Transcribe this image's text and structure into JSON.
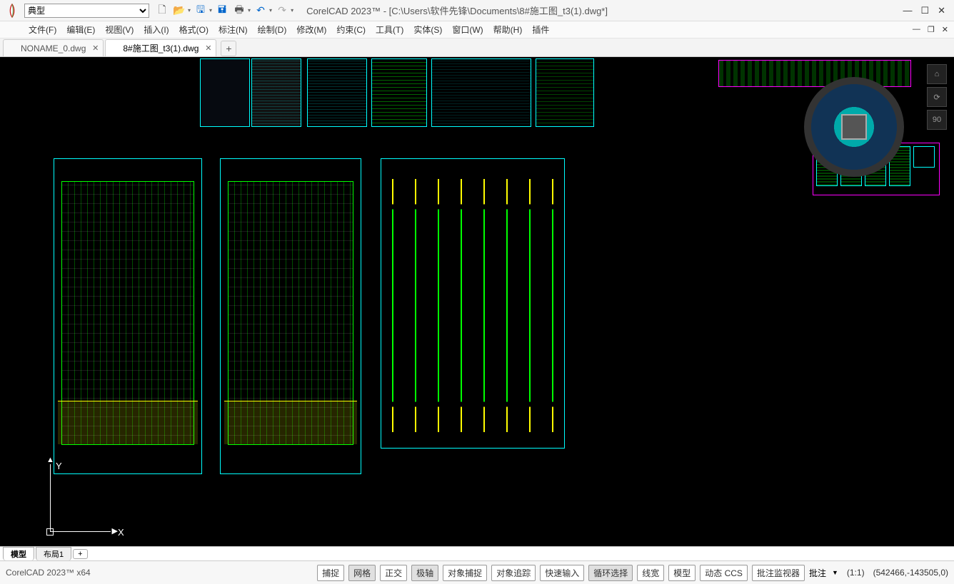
{
  "title": "CorelCAD 2023™ - [C:\\Users\\软件先锋\\Documents\\8#施工图_t3(1).dwg*]",
  "layer_selected": "典型",
  "menus": [
    "文件(F)",
    "编辑(E)",
    "视图(V)",
    "插入(I)",
    "格式(O)",
    "标注(N)",
    "绘制(D)",
    "修改(M)",
    "约束(C)",
    "工具(T)",
    "实体(S)",
    "窗口(W)",
    "帮助(H)",
    "插件"
  ],
  "tabs": {
    "t0": "NONAME_0.dwg",
    "t1": "8#施工图_t3(1).dwg"
  },
  "ucs": {
    "x": "X",
    "y": "Y"
  },
  "viewtools": {
    "north": "90"
  },
  "layout_tabs": {
    "model": "模型",
    "layout1": "布局1"
  },
  "status": {
    "app": "CorelCAD 2023™ x64",
    "buttons": {
      "snap": "捕捉",
      "grid": "网格",
      "ortho": "正交",
      "polar": "极轴",
      "osnap": "对象捕捉",
      "otrack": "对象追踪",
      "qinput": "快速输入",
      "cycle": "循环选择",
      "lwt": "线宽",
      "model": "模型",
      "dcss": "动态 CCS",
      "annomon": "批注监视器",
      "anno": "批注"
    },
    "scale": "(1:1)",
    "coords": "(542466,-143505,0)"
  }
}
